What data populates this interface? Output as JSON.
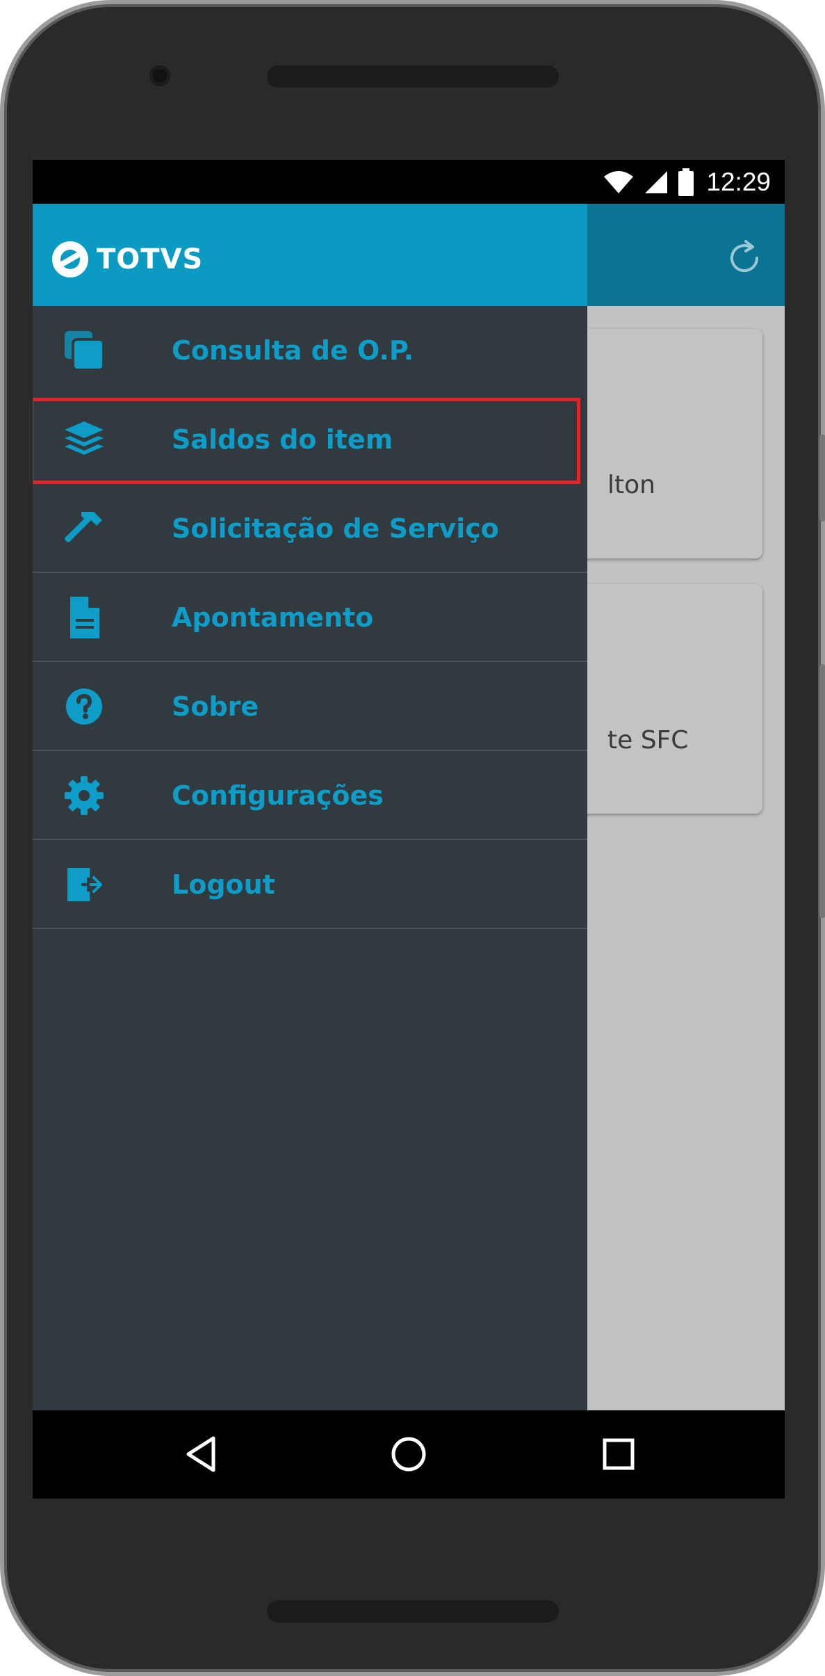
{
  "status_bar": {
    "time": "12:29",
    "icons": [
      "wifi-icon",
      "signal-icon",
      "battery-icon"
    ]
  },
  "app": {
    "header_color": "#0b7493",
    "cards": [
      {
        "label_partial": "lton",
        "icon": "filter-icon"
      },
      {
        "label_partial": "te SFC",
        "icon": "archive-down-icon"
      }
    ]
  },
  "drawer": {
    "logo_text": "TOTVS",
    "header_color": "#0b9bc2",
    "items": [
      {
        "label": "Consulta de O.P.",
        "icon": "copy-icon",
        "selected": false
      },
      {
        "label": "Saldos do item",
        "icon": "layers-icon",
        "selected": true
      },
      {
        "label": "Solicitação de Serviço",
        "icon": "hammer-icon",
        "selected": false
      },
      {
        "label": "Apontamento",
        "icon": "document-icon",
        "selected": false
      },
      {
        "label": "Sobre",
        "icon": "help-circle-icon",
        "selected": false
      },
      {
        "label": "Configurações",
        "icon": "gear-icon",
        "selected": false
      },
      {
        "label": "Logout",
        "icon": "logout-icon",
        "selected": false
      }
    ]
  },
  "nav_bar": {
    "buttons": [
      "back-icon",
      "home-icon",
      "recent-apps-icon"
    ]
  },
  "colors": {
    "accent": "#0e9cc8",
    "drawer_bg": "#313a3e",
    "highlight": "#e3232b"
  }
}
